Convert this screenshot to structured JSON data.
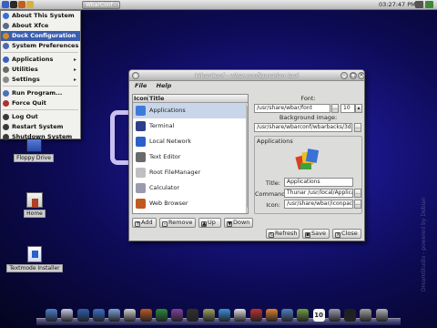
{
  "top_panel": {
    "task_button": "WbarConf - wbar.con...",
    "clock": "03:27:47 PM"
  },
  "menu": {
    "items": [
      {
        "label": "About This System",
        "icon": "info-icon",
        "color": "#3b6fd0",
        "submenu": false
      },
      {
        "label": "About Xfce",
        "icon": "xfce-icon",
        "color": "#5b6a8a",
        "submenu": false
      },
      {
        "label": "Dock Configuration",
        "icon": "dock-icon",
        "color": "#d08a2a",
        "submenu": false,
        "selected": true
      },
      {
        "label": "System Preferences",
        "icon": "preferences-icon",
        "color": "#4a6cb0",
        "submenu": false
      },
      {
        "label": "Applications",
        "icon": "applications-icon",
        "color": "#3b60c0",
        "submenu": true
      },
      {
        "label": "Utilities",
        "icon": "utilities-icon",
        "color": "#6a6a6a",
        "submenu": true
      },
      {
        "label": "Settings",
        "icon": "settings-icon",
        "color": "#8a8a8a",
        "submenu": true
      },
      {
        "label": "Run Program...",
        "icon": "run-icon",
        "color": "#4a70b8",
        "submenu": false
      },
      {
        "label": "Force Quit",
        "icon": "force-quit-icon",
        "color": "#b03030",
        "submenu": false
      },
      {
        "label": "Log Out",
        "icon": "logout-icon",
        "color": "#3a3a3a",
        "submenu": false
      },
      {
        "label": "Restart System",
        "icon": "restart-icon",
        "color": "#3a3a3a",
        "submenu": false
      },
      {
        "label": "Shutdown System",
        "icon": "shutdown-icon",
        "color": "#3a3a3a",
        "submenu": false
      }
    ]
  },
  "desktop": {
    "icons": [
      {
        "label": "Floppy Drive",
        "icon": "floppy-icon"
      },
      {
        "label": "Home",
        "icon": "home-icon"
      },
      {
        "label": "Textmode Installer",
        "icon": "installer-icon"
      }
    ]
  },
  "window": {
    "title": "WbarConf - wbar.configuration tool",
    "menubar": [
      "File",
      "Help"
    ],
    "list": {
      "headers": [
        "Icon",
        "Title"
      ],
      "rows": [
        {
          "title": "Applications",
          "icon": "applications-icon",
          "color": "#3e7ad8",
          "selected": true
        },
        {
          "title": "Terminal",
          "icon": "terminal-icon",
          "color": "#2c3f8a"
        },
        {
          "title": "Local Network",
          "icon": "network-icon",
          "color": "#2a60c8"
        },
        {
          "title": "Text Editor",
          "icon": "text-editor-icon",
          "color": "#6a6a6a"
        },
        {
          "title": "Root FileManager",
          "icon": "filemanager-icon",
          "color": "#c0c0c0"
        },
        {
          "title": "Calculator",
          "icon": "calculator-icon",
          "color": "#9a9ab0"
        },
        {
          "title": "Web Browser",
          "icon": "browser-icon",
          "color": "#c05a20"
        }
      ]
    },
    "list_buttons": {
      "add": "Add",
      "remove": "Remove",
      "up": "Up",
      "down": "Down"
    },
    "font": {
      "label": "Font:",
      "path": "/usr/share/wbar/font",
      "size": "10"
    },
    "background": {
      "label": "Background image:",
      "path": "/usr/share/wbarconf/wbarbacks/3de"
    },
    "group": {
      "title": "Applications",
      "title_label": "Title:",
      "title_value": "Applications",
      "command_label": "Command:",
      "command_value": "Thunar /usr/local/Applica",
      "icon_label": "Icon:",
      "icon_value": "/usr/share/wbar/iconpac"
    },
    "bottom_buttons": {
      "refresh": "Refresh",
      "save": "Save",
      "close": "Close"
    },
    "ellipsis": "..."
  },
  "credit": "DreamStudio - powered by Debian",
  "dock": {
    "items": [
      {
        "icon": "finder-icon",
        "color": "#4a7fd0"
      },
      {
        "icon": "mail-icon",
        "color": "#c8c8e8"
      },
      {
        "icon": "monitor-icon",
        "color": "#2a5fb0"
      },
      {
        "icon": "screen-icon",
        "color": "#3a70c8"
      },
      {
        "icon": "network-icon",
        "color": "#7aa0d8"
      },
      {
        "icon": "disc-icon",
        "color": "#d0d0d0"
      },
      {
        "icon": "browser-icon",
        "color": "#c05a20"
      },
      {
        "icon": "chat-icon",
        "color": "#2a8a3a"
      },
      {
        "icon": "music-icon",
        "color": "#8040a0"
      },
      {
        "icon": "video-icon",
        "color": "#303030"
      },
      {
        "icon": "photo-icon",
        "color": "#a0a060"
      },
      {
        "icon": "web-icon",
        "color": "#3a90d8"
      },
      {
        "icon": "document-icon",
        "color": "#e0e0e0"
      },
      {
        "icon": "pdf-icon",
        "color": "#c03030"
      },
      {
        "icon": "paint-icon",
        "color": "#e08030"
      },
      {
        "icon": "office-icon",
        "color": "#5080c0"
      },
      {
        "icon": "editor-icon",
        "color": "#70a040"
      },
      {
        "icon": "calendar-icon",
        "color": "#f0f0f0"
      },
      {
        "icon": "calculator-icon",
        "color": "#9a9ab0"
      },
      {
        "icon": "terminal-icon",
        "color": "#202020"
      },
      {
        "icon": "settings-icon",
        "color": "#a0a0a0"
      },
      {
        "icon": "trash-icon",
        "color": "#b0b0b8"
      }
    ]
  },
  "dock_calendar_day": "10"
}
